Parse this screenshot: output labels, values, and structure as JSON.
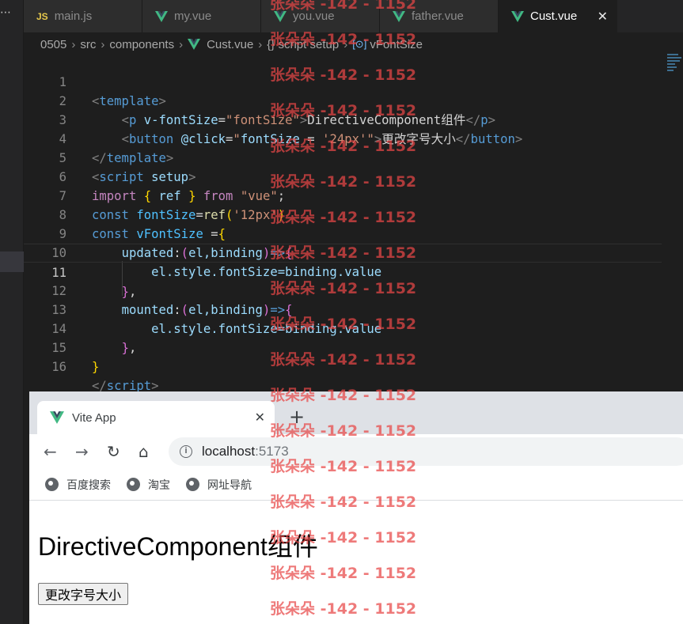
{
  "activity": {
    "more_label": "⋯"
  },
  "tabs": [
    {
      "label": "main.js",
      "icon": "js-file-icon",
      "icon_text": "JS"
    },
    {
      "label": "my.vue",
      "icon": "vue-file-icon"
    },
    {
      "label": "you.vue",
      "icon": "vue-file-icon"
    },
    {
      "label": "father.vue",
      "icon": "vue-file-icon"
    },
    {
      "label": "Cust.vue",
      "icon": "vue-file-icon",
      "active": true,
      "close": "✕"
    }
  ],
  "breadcrumb": {
    "items": [
      "0505",
      "src",
      "components",
      "Cust.vue",
      "{} script setup",
      "vFontSize"
    ],
    "sep": "›",
    "sym": "[⊙]"
  },
  "editor": {
    "current_line": 11,
    "line_numbers": [
      "1",
      "2",
      "3",
      "4",
      "5",
      "6",
      "7",
      "8",
      "9",
      "10",
      "11",
      "12",
      "13",
      "14",
      "15",
      "16"
    ]
  },
  "code": {
    "l1": {
      "lt": "<",
      "tag": "template",
      "gt": ">"
    },
    "l2": {
      "indent": "    ",
      "lt": "<",
      "tag": "p",
      "sp": " ",
      "attr": "v-fontSize",
      "eq": "=",
      "val": "\"fontSize\"",
      "gt": ">",
      "text": "DirectiveComponent组件",
      "close_lt": "</",
      "close_tag": "p",
      "close_gt": ">"
    },
    "l3": {
      "indent": "    ",
      "lt": "<",
      "tag": "button",
      "sp": " ",
      "attr": "@click",
      "eq": "=",
      "q1": "\"",
      "var": "fontSize",
      "assign": " = ",
      "val": "'24px'",
      "q2": "\"",
      "gt": ">",
      "text": "更改字号大小",
      "close_lt": "</",
      "close_tag": "button",
      "close_gt": ">"
    },
    "l4": {
      "lt": "</",
      "tag": "template",
      "gt": ">"
    },
    "l5": {
      "lt": "<",
      "tag": "script",
      "sp": " ",
      "attr": "setup",
      "gt": ">"
    },
    "l6": {
      "kw": "import",
      "ob": " { ",
      "name": "ref",
      "cb": " } ",
      "from": "from",
      "sp": " ",
      "str": "\"vue\"",
      "semi": ";"
    },
    "l7": {
      "kw": "const",
      "sp": " ",
      "name": "fontSize",
      "eq": "=",
      "fn": "ref",
      "op": "(",
      "str": "'12px'",
      "cp": ")"
    },
    "l8": {
      "kw": "const",
      "sp": " ",
      "name": "vFontSize",
      "eq": " =",
      "ob": "{"
    },
    "l9": {
      "indent": "    ",
      "name": "updated",
      "colon": ":",
      "op": "(",
      "args": "el,binding",
      "cp": ")",
      "arrow": "=>",
      "ob": "{"
    },
    "l10": {
      "indent": "        ",
      "text": "el.style.fontSize=binding.value"
    },
    "l11": {
      "indent": "    ",
      "cb": "}",
      "comma": ","
    },
    "l12": {
      "indent": "    ",
      "name": "mounted",
      "colon": ":",
      "op": "(",
      "args": "el,binding",
      "cp": ")",
      "arrow": "=>",
      "ob": "{"
    },
    "l13": {
      "indent": "        ",
      "text": "el.style.fontSize=binding.value"
    },
    "l14": {
      "indent": "    ",
      "cb": "}",
      "comma": ","
    },
    "l15": {
      "cb": "}"
    },
    "l16": {
      "lt": "</",
      "tag": "script",
      "gt": ">"
    }
  },
  "browser": {
    "tab_title": "Vite App",
    "tab_close": "✕",
    "new_tab": "+",
    "back": "←",
    "forward": "→",
    "reload": "↻",
    "home": "⌂",
    "info": "i",
    "url_host": "localhost",
    "url_port": ":5173",
    "bookmarks": [
      "百度搜索",
      "淘宝",
      "网址导航"
    ],
    "page_heading": "DirectiveComponent组件",
    "page_button": "更改字号大小"
  },
  "watermark": "张朵朵 -142 - 1152",
  "colors": {
    "accent_vue": "#41b883",
    "editor_bg": "#1e1e1e",
    "watermark": "#e84646"
  }
}
